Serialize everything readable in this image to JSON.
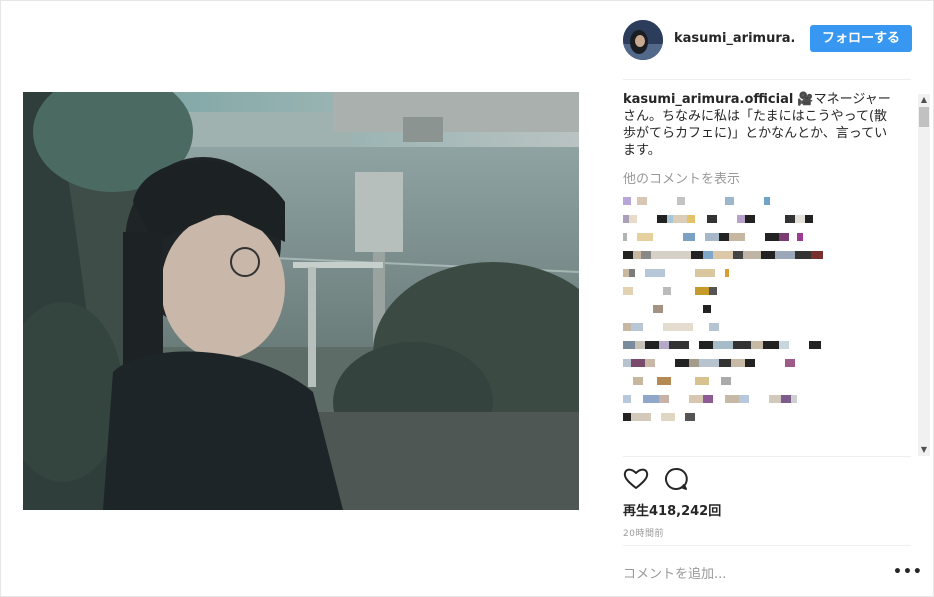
{
  "post": {
    "username": "kasumi_arimura.of",
    "follow_label": "フォローする",
    "caption_user": "kasumi_arimura.official",
    "caption_text": " 🎥マネージャーさん。ちなみに私は「たまにはこうやって(散歩がてらカフェに)」とかなんとか、言っています。",
    "view_more_comments": "他のコメントを表示",
    "views_label": "再生418,242回",
    "timestamp": "20時間前",
    "add_comment_placeholder": "コメントを追加...",
    "more_options_label": "•••"
  },
  "icons": {
    "like": "heart-icon",
    "comment": "comment-bubble-icon",
    "avatar": "profile-avatar",
    "more": "ellipsis-icon",
    "scroll_up": "scroll-up-arrow",
    "scroll_down": "scroll-down-arrow"
  },
  "colors": {
    "follow_button": "#3897f0",
    "text_primary": "#262626",
    "text_secondary": "#999999",
    "divider": "#efefef"
  }
}
